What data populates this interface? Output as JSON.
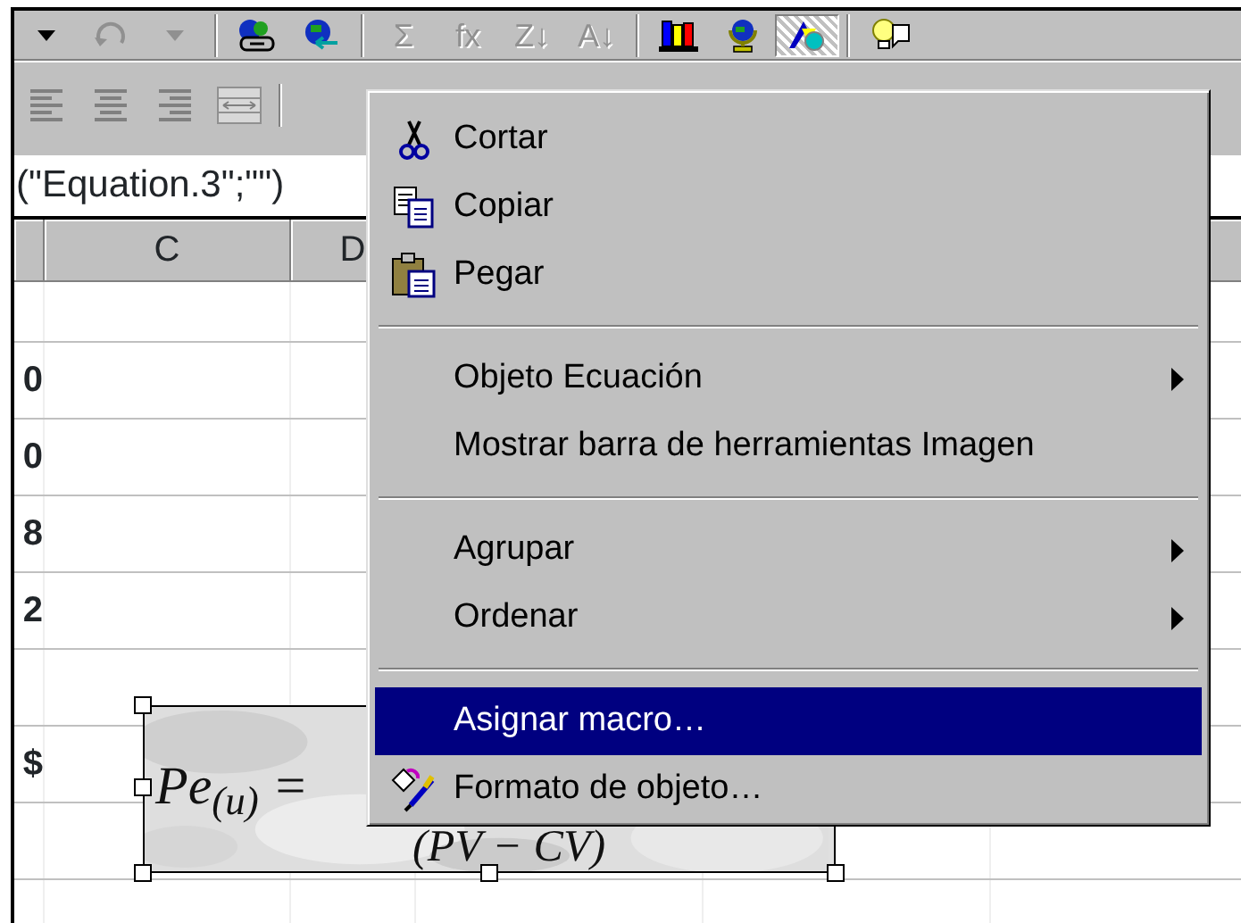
{
  "standard_toolbar": {
    "glyph_buttons": [
      {
        "glyph": "Σ",
        "disabled": true
      },
      {
        "glyph": "fx",
        "disabled": true
      },
      {
        "glyph": "Z↓",
        "disabled": true
      },
      {
        "glyph": "A↓",
        "disabled": true
      }
    ],
    "drawing_button": {
      "pressed": true
    }
  },
  "formula_bar": {
    "value": "(\"Equation.3\";\"\")"
  },
  "sheet": {
    "columns": [
      {
        "label": "C"
      },
      {
        "label": "D"
      }
    ],
    "rows": [
      {},
      {
        "column_1": "0"
      },
      {
        "column_1": "0"
      },
      {
        "column_1": "8"
      },
      {
        "column_1": "2"
      },
      {},
      {
        "column_1": "$"
      },
      {},
      {}
    ]
  },
  "equation_object": {
    "selected": true,
    "lhs": "Pe$_{(u)}$ =",
    "rhs": "(PV − CV)"
  },
  "context_menu": {
    "items": [
      {
        "kind": "item",
        "label": "Cortar",
        "submenu": false,
        "selected": false
      },
      {
        "kind": "item",
        "label": "Copiar",
        "submenu": false,
        "selected": false
      },
      {
        "kind": "item",
        "label": "Pegar",
        "submenu": false,
        "selected": false
      },
      {
        "kind": "separator"
      },
      {
        "kind": "item",
        "label": "Objeto Ecuación",
        "submenu": true,
        "selected": false
      },
      {
        "kind": "item",
        "label": "Mostrar barra de herramientas Imagen",
        "submenu": false,
        "selected": false
      },
      {
        "kind": "separator"
      },
      {
        "kind": "item",
        "label": "Agrupar",
        "submenu": true,
        "selected": false
      },
      {
        "kind": "item",
        "label": "Ordenar",
        "submenu": true,
        "selected": false
      },
      {
        "kind": "separator"
      },
      {
        "kind": "item",
        "label": "Asignar macro…",
        "submenu": false,
        "selected": true
      },
      {
        "kind": "item",
        "label": "Formato de objeto…",
        "submenu": false,
        "selected": false
      }
    ]
  }
}
